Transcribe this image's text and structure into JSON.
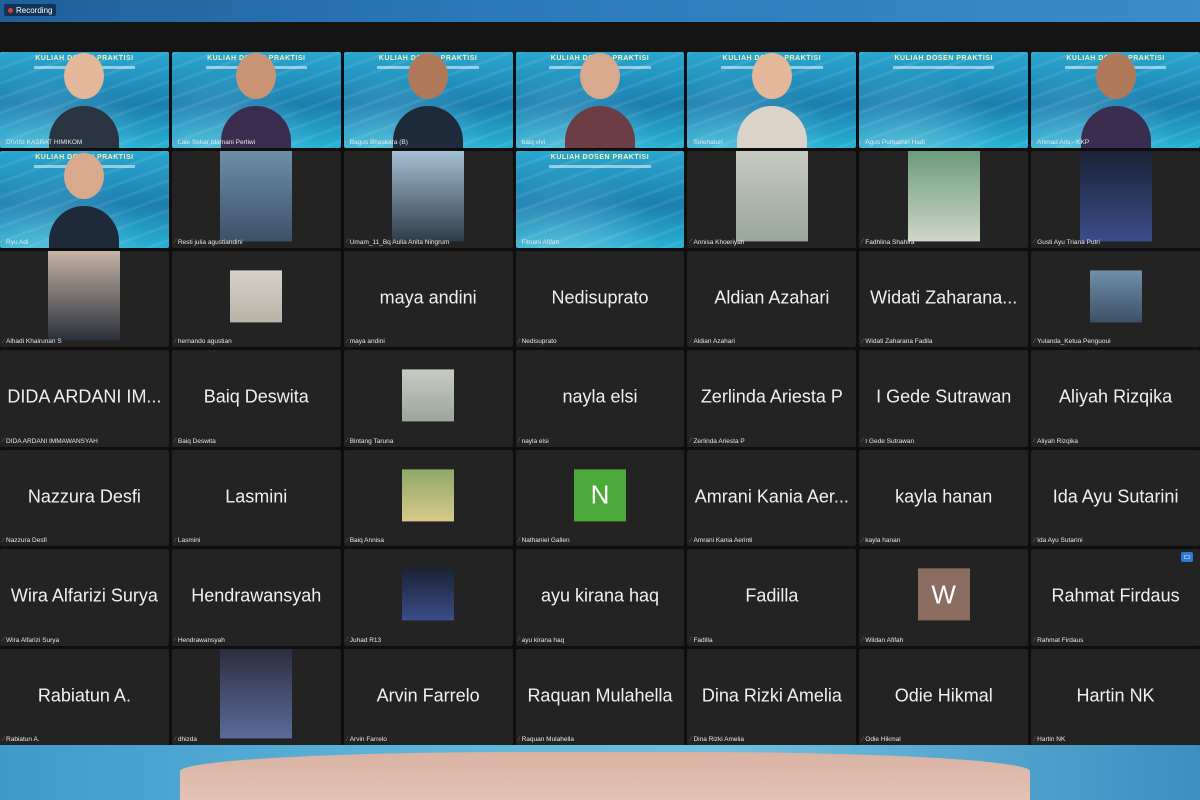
{
  "window": {
    "recording_label": "Recording"
  },
  "colors": {
    "active_speaker": "#7cd36a",
    "muted_mic": "#e54848",
    "slide_title": "#f5f1b8"
  },
  "slide_title": "KULIAH DOSEN PRAKTISI",
  "tiles": [
    {
      "name": "DIVISI KASRAT HIMIKOM",
      "big": "",
      "kind": "slide-person",
      "active": true
    },
    {
      "name": "Lale Sekar Idamani Pertiwi",
      "big": "",
      "kind": "slide-person"
    },
    {
      "name": "Bagus Bhaskara (B)",
      "big": "",
      "kind": "slide-person"
    },
    {
      "name": "baiq vivi",
      "big": "",
      "kind": "slide-person"
    },
    {
      "name": "Solehaturi",
      "big": "",
      "kind": "slide-person"
    },
    {
      "name": "Agus Purbathin Hadi",
      "big": "",
      "kind": "slide"
    },
    {
      "name": "Ahmad Aris - KKP",
      "big": "",
      "kind": "slide-person"
    },
    {
      "name": "Ryu Adi",
      "big": "",
      "kind": "slide-person"
    },
    {
      "name": "Resti julia agustiandini",
      "big": "",
      "kind": "photo"
    },
    {
      "name": "Umam_11_Bq Aulia Anita Ningrum",
      "big": "",
      "kind": "photo"
    },
    {
      "name": "Fitriani Afifah",
      "big": "",
      "kind": "slide"
    },
    {
      "name": "Annisa Khoeriyah",
      "big": "",
      "kind": "photo"
    },
    {
      "name": "Fadhlina Shahira",
      "big": "",
      "kind": "photo"
    },
    {
      "name": "Gusti Ayu Triana Putri",
      "big": "",
      "kind": "photo"
    },
    {
      "name": "Alhadi Khairunan S",
      "big": "",
      "kind": "photo"
    },
    {
      "name": "hernando agustian",
      "big": "",
      "kind": "photo"
    },
    {
      "name": "maya andini",
      "big": "maya andini",
      "kind": "text"
    },
    {
      "name": "Nedisuprato",
      "big": "Nedisuprato",
      "kind": "text"
    },
    {
      "name": "Aldian Azahari",
      "big": "Aldian Azahari",
      "kind": "text"
    },
    {
      "name": "Widati Zaharana Fadila",
      "big": "Widati Zaharana...",
      "kind": "text"
    },
    {
      "name": "Yulanda_Ketua Penguoui",
      "big": "",
      "kind": "photo"
    },
    {
      "name": "DIDA ARDANI IMMAWANSYAH",
      "big": "DIDA ARDANI IM...",
      "kind": "text"
    },
    {
      "name": "Baiq Deswita",
      "big": "Baiq Deswita",
      "kind": "text"
    },
    {
      "name": "Bintang Taruna",
      "big": "",
      "kind": "photo"
    },
    {
      "name": "nayla elsi",
      "big": "nayla elsi",
      "kind": "text"
    },
    {
      "name": "Zerlinda Ariesta P",
      "big": "Zerlinda Ariesta P",
      "kind": "text"
    },
    {
      "name": "I Gede Sutrawan",
      "big": "I Gede Sutrawan",
      "kind": "text"
    },
    {
      "name": "Aliyah Rizqika",
      "big": "Aliyah Rizqika",
      "kind": "text"
    },
    {
      "name": "Nazzura Desfi",
      "big": "Nazzura Desfi",
      "kind": "text"
    },
    {
      "name": "Lasmini",
      "big": "Lasmini",
      "kind": "text"
    },
    {
      "name": "Baiq Annisa",
      "big": "",
      "kind": "photo"
    },
    {
      "name": "Nathaniel Gallen",
      "big": "",
      "kind": "avatar",
      "letter": "N",
      "avatar_color": "#4caa3a"
    },
    {
      "name": "Amrani Kania Aerinti",
      "big": "Amrani Kania Aer...",
      "kind": "text"
    },
    {
      "name": "kayla hanan",
      "big": "kayla hanan",
      "kind": "text"
    },
    {
      "name": "Ida Ayu Sutarini",
      "big": "Ida Ayu Sutarini",
      "kind": "text"
    },
    {
      "name": "Wira Alfarizi Surya",
      "big": "Wira Alfarizi Surya",
      "kind": "text"
    },
    {
      "name": "Hendrawansyah",
      "big": "Hendrawansyah",
      "kind": "text"
    },
    {
      "name": "Juhad R13",
      "big": "",
      "kind": "photo"
    },
    {
      "name": "ayu kirana haq",
      "big": "ayu kirana haq",
      "kind": "text"
    },
    {
      "name": "Fadilla",
      "big": "Fadilla",
      "kind": "text"
    },
    {
      "name": "Wildan Afifah",
      "big": "",
      "kind": "avatar",
      "letter": "W",
      "avatar_color": "#8a6d60"
    },
    {
      "name": "Rahmat Firdaus",
      "big": "Rahmat Firdaus",
      "kind": "text"
    },
    {
      "name": "Rabiatun A.",
      "big": "Rabiatun A.",
      "kind": "text"
    },
    {
      "name": "dhizda",
      "big": "",
      "kind": "photo"
    },
    {
      "name": "Arvin Farrelo",
      "big": "Arvin Farrelo",
      "kind": "text"
    },
    {
      "name": "Raquan Mulahella",
      "big": "Raquan Mulahella",
      "kind": "text"
    },
    {
      "name": "Dina Rizki Amelia",
      "big": "Dina Rizki Amelia",
      "kind": "text"
    },
    {
      "name": "Odie Hikmal",
      "big": "Odie Hikmal",
      "kind": "text"
    },
    {
      "name": "Hartin NK",
      "big": "Hartin NK",
      "kind": "text"
    }
  ]
}
